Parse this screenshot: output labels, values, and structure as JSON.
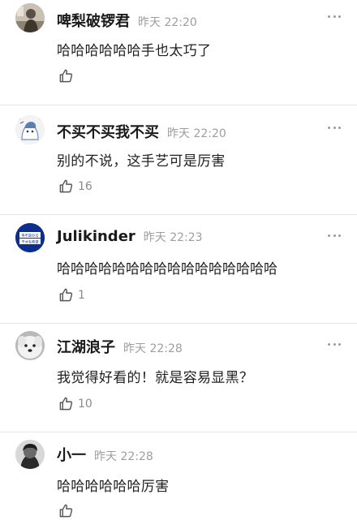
{
  "comments": [
    {
      "username": "啤梨破锣君",
      "time": "昨天 22:20",
      "text": "哈哈哈哈哈哈手也太巧了",
      "likes": "",
      "avatar_icon": "user-avatar-dark-figure"
    },
    {
      "username": "不买不买我不买",
      "time": "昨天 22:20",
      "text": "别的不说，这手艺可是厉害",
      "likes": "16",
      "avatar_icon": "user-avatar-cartoon"
    },
    {
      "username": "Julikinder",
      "time": "昨天 22:23",
      "text": "哈哈哈哈哈哈哈哈哈哈哈哈哈哈哈哈",
      "likes": "1",
      "avatar_icon": "user-avatar-blue-sign",
      "avatar_text": [
        "等不是办法",
        "干才有希望"
      ]
    },
    {
      "username": "江湖浪子",
      "time": "昨天 22:28",
      "text": "我觉得好看的！就是容易显黑？",
      "likes": "10",
      "avatar_icon": "user-avatar-white-dog"
    },
    {
      "username": "小一",
      "time": "昨天 22:28",
      "text": "哈哈哈哈哈哈厉害",
      "likes": "",
      "avatar_icon": "user-avatar-dark-portrait"
    }
  ]
}
